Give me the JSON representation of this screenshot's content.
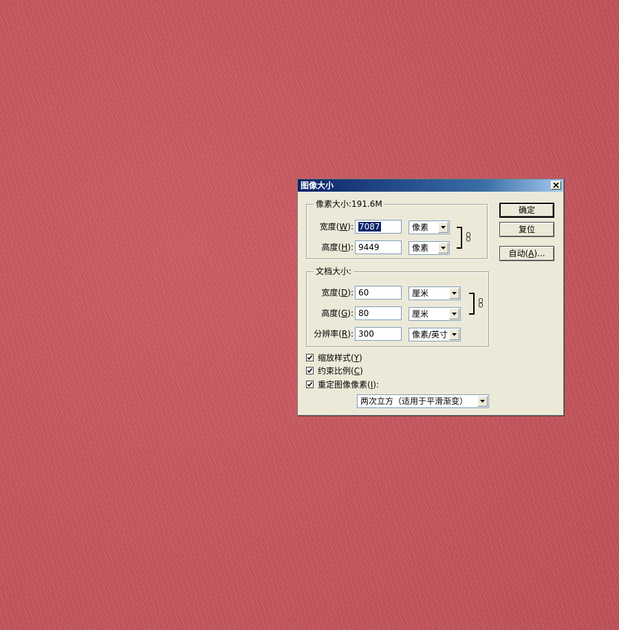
{
  "dialog": {
    "title": "图像大小",
    "pixel_dimensions": {
      "legend": "像素大小:191.6M",
      "width": {
        "label_prefix": "宽度(",
        "hotkey": "W",
        "label_suffix": "):",
        "value": "7087",
        "unit": "像素"
      },
      "height": {
        "label_prefix": "高度(",
        "hotkey": "H",
        "label_suffix": "):",
        "value": "9449",
        "unit": "像素"
      }
    },
    "document_size": {
      "legend": "文档大小:",
      "width": {
        "label_prefix": "宽度(",
        "hotkey": "D",
        "label_suffix": "):",
        "value": "60",
        "unit": "厘米"
      },
      "height": {
        "label_prefix": "高度(",
        "hotkey": "G",
        "label_suffix": "):",
        "value": "80",
        "unit": "厘米"
      },
      "resolution": {
        "label_prefix": "分辨率(",
        "hotkey": "R",
        "label_suffix": "):",
        "value": "300",
        "unit": "像素/英寸"
      }
    },
    "buttons": {
      "ok": "确定",
      "reset": "复位",
      "auto": {
        "prefix": "自动(",
        "hotkey": "A",
        "suffix": ")..."
      }
    },
    "options": {
      "scale_styles": {
        "prefix": "缩放样式(",
        "hotkey": "Y",
        "suffix": ")",
        "checked": true
      },
      "constrain_proportions": {
        "prefix": "约束比例(",
        "hotkey": "C",
        "suffix": ")",
        "checked": true
      },
      "resample_image": {
        "prefix": "重定图像像素(",
        "hotkey": "I",
        "suffix": "):",
        "checked": true
      }
    },
    "resample_method": "两次立方（适用于平滑渐变）"
  }
}
